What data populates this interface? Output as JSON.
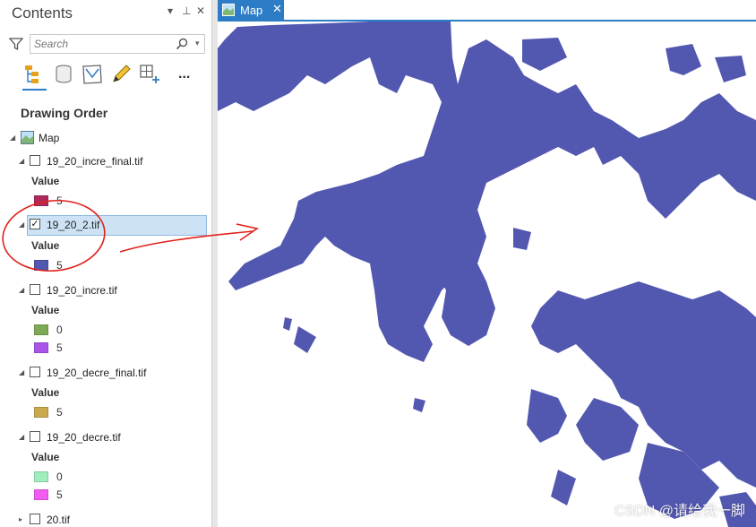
{
  "contents": {
    "title": "Contents",
    "controls": {
      "menu": "▾",
      "pin": "⊥",
      "close": "✕"
    },
    "search": {
      "placeholder": "Search",
      "value": ""
    },
    "toolbar": [
      "list-by-drawing-order-icon",
      "list-by-data-source-icon",
      "list-by-selection-icon",
      "list-by-editing-icon",
      "list-by-snapping-icon",
      "more-icon"
    ],
    "more_label": "...",
    "section_title": "Drawing Order",
    "map_node": {
      "label": "Map"
    },
    "layers": [
      {
        "name": "19_20_incre_final.tif",
        "checked": false,
        "selected": false,
        "legend_title": "Value",
        "classes": [
          {
            "value": "5",
            "color": "#b0295c"
          }
        ]
      },
      {
        "name": "19_20_2.tif",
        "checked": true,
        "selected": true,
        "legend_title": "Value",
        "classes": [
          {
            "value": "5",
            "color": "#5257b0"
          }
        ]
      },
      {
        "name": "19_20_incre.tif",
        "checked": false,
        "selected": false,
        "legend_title": "Value",
        "classes": [
          {
            "value": "0",
            "color": "#7faa55"
          },
          {
            "value": "5",
            "color": "#a855e8"
          }
        ]
      },
      {
        "name": "19_20_decre_final.tif",
        "checked": false,
        "selected": false,
        "legend_title": "Value",
        "classes": [
          {
            "value": "5",
            "color": "#c9a84e"
          }
        ]
      },
      {
        "name": "19_20_decre.tif",
        "checked": false,
        "selected": false,
        "legend_title": "Value",
        "classes": [
          {
            "value": "0",
            "color": "#a0eebc"
          },
          {
            "value": "5",
            "color": "#f25cf0"
          }
        ]
      },
      {
        "name": "20.tif",
        "checked": false,
        "selected": false
      }
    ]
  },
  "map": {
    "tab_label": "Map",
    "tab_close": "✕",
    "fill_color": "#5257b0",
    "background_color": "#ffffff",
    "watermark": "CSDN @请给我一脚"
  },
  "annotation": {
    "color": "#e0201a"
  }
}
